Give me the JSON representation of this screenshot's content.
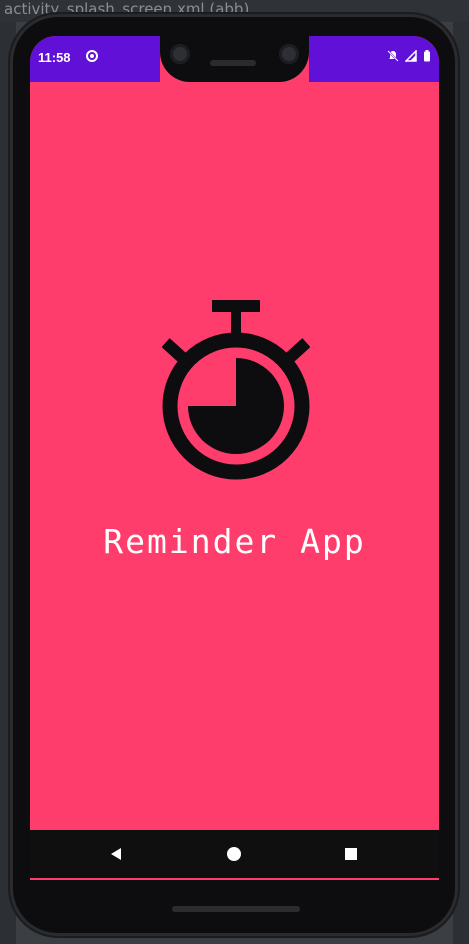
{
  "background": {
    "ide_tab_text": "activity_splash_screen.xml (abb)"
  },
  "status_bar": {
    "time": "11:58",
    "color": "#6110d8"
  },
  "screen": {
    "background_color": "#ff3d6c",
    "logo_icon": "stopwatch-icon",
    "app_title": "Reminder App"
  },
  "navigation": {
    "back_icon": "back-triangle-icon",
    "home_icon": "home-circle-icon",
    "recents_icon": "recents-square-icon"
  }
}
